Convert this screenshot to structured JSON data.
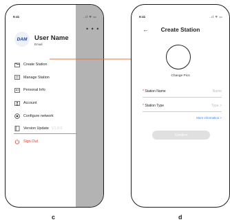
{
  "status_bar": {
    "time": "9:41",
    "icons": "..ıl ᯤ ▭"
  },
  "left_screen": {
    "menu_dots": "• • •",
    "avatar_text": "DAM",
    "user_name": "User Name",
    "user_email": "Email",
    "menu": [
      {
        "label": "Create Station",
        "icon": "folder-icon"
      },
      {
        "label": "Manage Station",
        "icon": "manage-icon"
      },
      {
        "label": "Personal Info",
        "icon": "id-card-icon"
      },
      {
        "label": "Account",
        "icon": "account-icon"
      },
      {
        "label": "Configure network",
        "icon": "network-icon"
      },
      {
        "label": "Version Update",
        "icon": "book-icon",
        "value": "V1.0.0"
      },
      {
        "label": "Sign Out",
        "icon": "power-icon"
      }
    ],
    "shade_color": "#b3b3b3",
    "signout_color": "#d33a2c"
  },
  "connector_color": "#e8743b",
  "right_screen": {
    "back_icon": "←",
    "title": "Create Station",
    "change_pics": "Change Pics",
    "fields": [
      {
        "required_mark": "*",
        "label": "Station Name",
        "value": "Name"
      },
      {
        "required_mark": "*",
        "label": "Station Type",
        "value": "Type  >"
      }
    ],
    "more_info": "More information  >",
    "confirm": "Confirm",
    "accent": "#3f7fe0"
  },
  "captions": {
    "left": "c",
    "right": "d"
  }
}
